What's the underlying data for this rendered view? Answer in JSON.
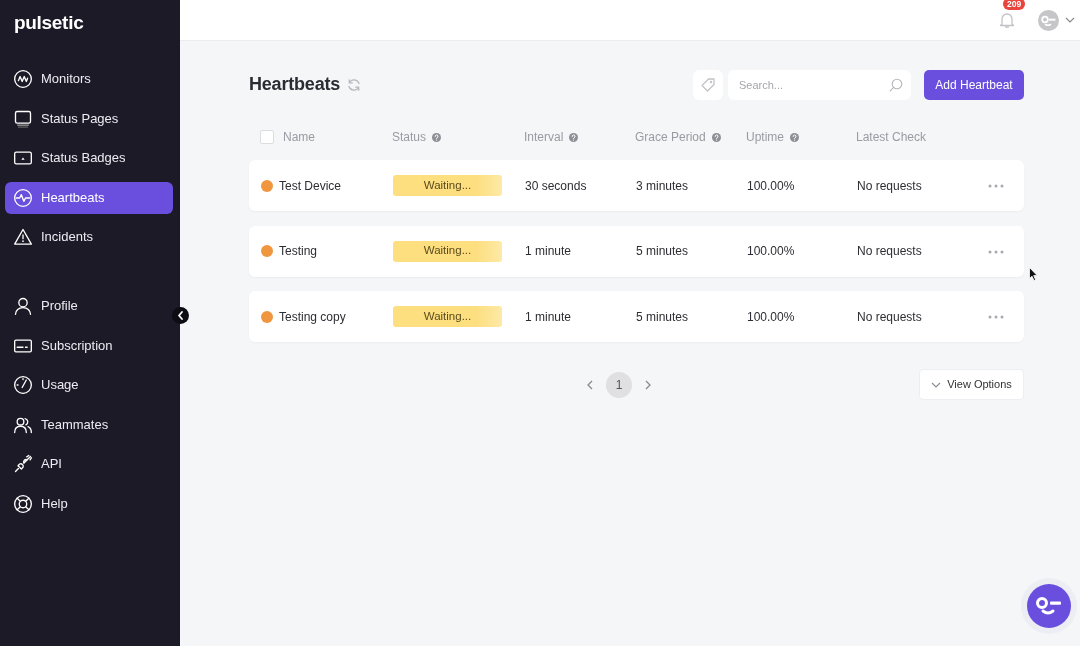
{
  "sidebar": {
    "logo": "pulsetic",
    "sections": [
      {
        "items": [
          {
            "label": "Monitors",
            "selected": false
          },
          {
            "label": "Status Pages",
            "selected": false
          },
          {
            "label": "Status Badges",
            "selected": false
          },
          {
            "label": "Heartbeats",
            "selected": true
          },
          {
            "label": "Incidents",
            "selected": false
          }
        ]
      },
      {
        "items": [
          {
            "label": "Profile",
            "selected": false
          },
          {
            "label": "Subscription",
            "selected": false
          },
          {
            "label": "Usage",
            "selected": false
          },
          {
            "label": "Teammates",
            "selected": false
          },
          {
            "label": "API",
            "selected": false
          },
          {
            "label": "Help",
            "selected": false
          }
        ]
      }
    ]
  },
  "topbar": {
    "notification_count": "209"
  },
  "page": {
    "title": "Heartbeats",
    "search": {
      "placeholder": "Search..."
    },
    "add_button": "Add Heartbeat"
  },
  "table": {
    "select_all": {
      "checked": false
    },
    "columns": [
      {
        "label": "Name",
        "help": false
      },
      {
        "label": "Status",
        "help": true
      },
      {
        "label": "Interval",
        "help": true
      },
      {
        "label": "Grace Period",
        "help": true
      },
      {
        "label": "Uptime",
        "help": true
      },
      {
        "label": "Latest Check",
        "help": false
      }
    ],
    "rows": [
      {
        "name": "Test Device",
        "color": "#f0963f",
        "status": "Waiting...",
        "interval": "30 seconds",
        "grace_period": "3 minutes",
        "uptime": "100.00%",
        "latest_check": "No requests"
      },
      {
        "name": "Testing",
        "color": "#f0963f",
        "status": "Waiting...",
        "interval": "1 minute",
        "grace_period": "5 minutes",
        "uptime": "100.00%",
        "latest_check": "No requests"
      },
      {
        "name": "Testing copy",
        "color": "#f0963f",
        "status": "Waiting...",
        "interval": "1 minute",
        "grace_period": "5 minutes",
        "uptime": "100.00%",
        "latest_check": "No requests"
      }
    ]
  },
  "pagination": {
    "pages": [
      {
        "label": "1",
        "selected": true
      }
    ]
  },
  "view_options": {
    "label": "View Options"
  }
}
